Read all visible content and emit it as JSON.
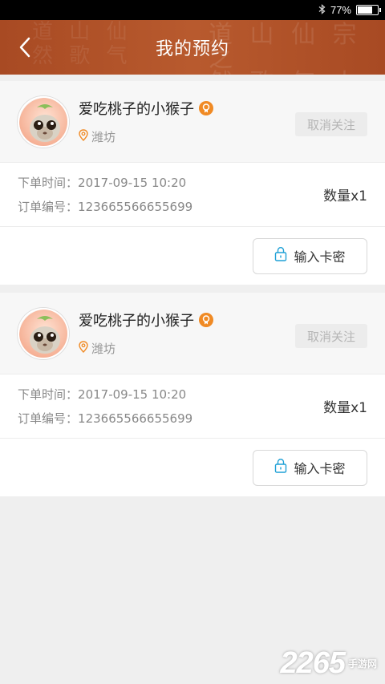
{
  "status_bar": {
    "battery": "77%",
    "battery_level": 0.77
  },
  "header": {
    "title": "我的预约"
  },
  "orders": [
    {
      "user_name": "爱吃桃子的小猴子",
      "location": "潍坊",
      "unfollow_label": "取消关注",
      "order_time_label": "下单时间",
      "order_time": "2017-09-15 10:20",
      "order_no_label": "订单编号",
      "order_no": "123665566655699",
      "quantity": "数量x1",
      "card_pw_label": "输入卡密"
    },
    {
      "user_name": "爱吃桃子的小猴子",
      "location": "潍坊",
      "unfollow_label": "取消关注",
      "order_time_label": "下单时间",
      "order_time": "2017-09-15 10:20",
      "order_no_label": "订单编号",
      "order_no": "123665566655699",
      "quantity": "数量x1",
      "card_pw_label": "输入卡密"
    }
  ],
  "watermark": {
    "number": "2265",
    "site": "手游网"
  },
  "colors": {
    "accent": "#a84a23",
    "badge": "#f08a24",
    "location_icon": "#f08a24"
  }
}
